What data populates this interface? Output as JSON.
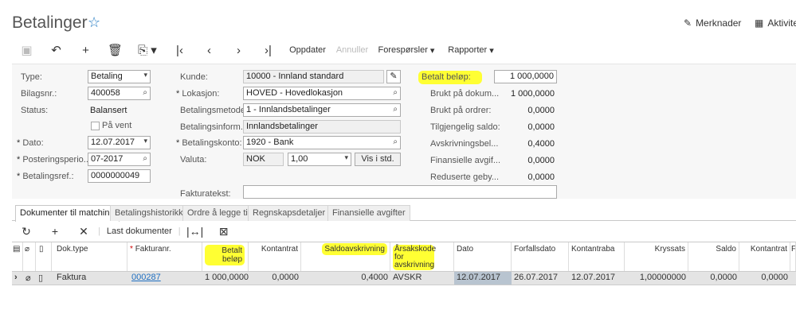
{
  "header": {
    "title": "Betalinger",
    "notes_label": "Merknader",
    "activities_label": "Aktivite"
  },
  "toolbar": {
    "refresh_label": "Oppdater",
    "cancel_label": "Annuller",
    "requests_label": "Forespørsler",
    "reports_label": "Rapporter"
  },
  "form": {
    "type_label": "Type:",
    "type_value": "Betaling",
    "doc_label": "Bilagsnr.:",
    "doc_value": "400058",
    "status_label": "Status:",
    "status_value": "Balansert",
    "hold_label": "På vent",
    "date_label": "Dato:",
    "date_value": "12.07.2017",
    "period_label": "Posteringsperio...",
    "period_value": "07-2017",
    "ref_label": "Betalingsref.:",
    "ref_value": "0000000049",
    "customer_label": "Kunde:",
    "customer_value": "10000 - Innland standard",
    "location_label": "Lokasjon:",
    "location_value": "HOVED - Hovedlokasjon",
    "method_label": "Betalingsmetode:",
    "method_value": "1 - Innlandsbetalinger",
    "info_label": "Betalingsinform...",
    "info_value": "Innlandsbetalinger",
    "account_label": "Betalingskonto:",
    "account_value": "1920 - Bank",
    "currency_label": "Valuta:",
    "currency_value": "NOK",
    "rate_value": "1,00",
    "view_btn": "Vis i std.",
    "invoice_text_label": "Fakturatekst:",
    "invoice_text_value": "",
    "paid_label": "Betalt beløp:",
    "paid_value": "1 000,0000",
    "used_doc_label": "Brukt på dokum...",
    "used_doc_value": "1 000,0000",
    "used_order_label": "Brukt på ordrer:",
    "used_order_value": "0,0000",
    "avail_label": "Tilgjengelig saldo:",
    "avail_value": "0,0000",
    "writeoff_label": "Avskrivningsbel...",
    "writeoff_value": "0,4000",
    "finfee_label": "Finansielle avgif...",
    "finfee_value": "0,0000",
    "redfee_label": "Reduserte geby...",
    "redfee_value": "0,0000"
  },
  "tabs": [
    "Dokumenter til matching",
    "Betalingshistorikk",
    "Ordre å legge til",
    "Regnskapsdetaljer",
    "Finansielle avgifter"
  ],
  "grid_toolbar": {
    "load_label": "Last dokumenter"
  },
  "grid": {
    "headers": [
      "Dok.type",
      "Fakturanr.",
      "Betalt beløp",
      "Kontantrat",
      "Saldoavskrivning",
      "Årsakskode for avskrivning",
      "Dato",
      "Forfallsdato",
      "Kontantraba",
      "Kryssats",
      "Saldo",
      "Kontantrat",
      "F"
    ],
    "row": [
      "Faktura",
      "000287",
      "1 000,0000",
      "0,0000",
      "0,4000",
      "AVSKR",
      "12.07.2017",
      "26.07.2017",
      "12.07.2017",
      "1,00000000",
      "0,0000",
      "0,0000",
      ""
    ]
  },
  "colors": {
    "highlight": "#ffff33",
    "accent": "#1f78c1"
  }
}
